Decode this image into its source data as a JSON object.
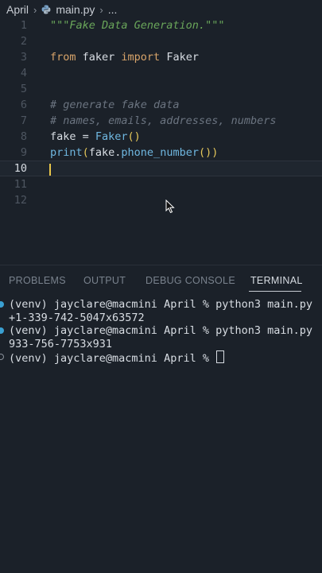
{
  "breadcrumb": {
    "folder": "April",
    "file": "main.py",
    "more": "..."
  },
  "editor": {
    "lines": [
      {
        "n": "1",
        "tokens": [
          {
            "t": "\"\"\"Fake Data Generation.\"\"\"",
            "c": "doc"
          }
        ]
      },
      {
        "n": "2",
        "tokens": []
      },
      {
        "n": "3",
        "tokens": [
          {
            "t": "from",
            "c": "kw"
          },
          {
            "t": " faker ",
            "c": ""
          },
          {
            "t": "import",
            "c": "kw"
          },
          {
            "t": " Faker",
            "c": ""
          }
        ]
      },
      {
        "n": "4",
        "tokens": []
      },
      {
        "n": "5",
        "tokens": []
      },
      {
        "n": "6",
        "tokens": [
          {
            "t": "# generate fake data",
            "c": "cmt"
          }
        ]
      },
      {
        "n": "7",
        "tokens": [
          {
            "t": "# names, emails, addresses, numbers",
            "c": "cmt"
          }
        ]
      },
      {
        "n": "8",
        "tokens": [
          {
            "t": "fake = ",
            "c": ""
          },
          {
            "t": "Faker",
            "c": "fn"
          },
          {
            "t": "()",
            "c": "paren"
          }
        ]
      },
      {
        "n": "9",
        "tokens": [
          {
            "t": "print",
            "c": "fn"
          },
          {
            "t": "(",
            "c": "paren"
          },
          {
            "t": "fake.",
            "c": ""
          },
          {
            "t": "phone_number",
            "c": "fn"
          },
          {
            "t": "()",
            "c": "paren"
          },
          {
            "t": ")",
            "c": "paren"
          }
        ]
      },
      {
        "n": "10",
        "tokens": [],
        "current": true
      },
      {
        "n": "11",
        "tokens": []
      },
      {
        "n": "12",
        "tokens": []
      }
    ]
  },
  "panel": {
    "tabs": [
      "PROBLEMS",
      "OUTPUT",
      "DEBUG CONSOLE",
      "TERMINAL"
    ],
    "active_tab": "TERMINAL"
  },
  "terminal": {
    "lines": [
      {
        "text": "(venv) jayclare@macmini April % python3 main.py",
        "dot": "filled"
      },
      {
        "text": "+1-339-742-5047x63572",
        "dot": ""
      },
      {
        "text": "(venv) jayclare@macmini April % python3 main.py",
        "dot": "filled"
      },
      {
        "text": "933-756-7753x931",
        "dot": ""
      },
      {
        "text": "(venv) jayclare@macmini April % ",
        "dot": "hollow",
        "cursor": true
      }
    ]
  },
  "colors": {
    "background": "#1b2129",
    "cursor": "#e8c64a",
    "accent": "#3aa0d2"
  }
}
